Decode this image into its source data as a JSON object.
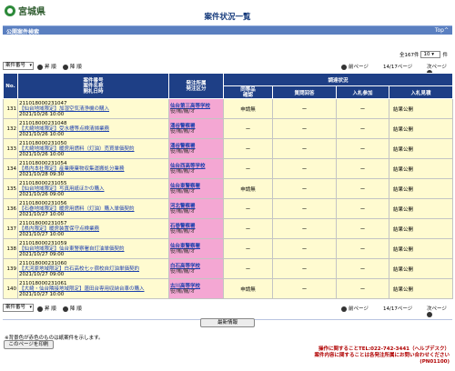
{
  "header": {
    "logo_text": "宮城県",
    "page_title": "案件状況一覧"
  },
  "bar": {
    "title": "公開案件検索",
    "top_link": "Top^"
  },
  "controls": {
    "sort_select": "案件番号",
    "sort_up": "昇 順",
    "sort_down": "降 順",
    "prev_label": "前ページ",
    "page_info": "14/17ページ",
    "next_label": "次ページ"
  },
  "count": {
    "total": "全167件",
    "per_page": "10",
    "unit": "件"
  },
  "table": {
    "headers": {
      "no": "No.",
      "case": "案件番号\n案件名称\n開札日時",
      "dept": "発注所属\n発注区分",
      "survey": "調達状況",
      "same_item": "同等品\n確認",
      "question": "質問回答",
      "bid_join": "入札参加",
      "bid_result": "入札見積"
    },
    "rows": [
      {
        "no": "131",
        "num": "211018000231047",
        "name": "【仙台地域限定】加湿空気清浄機の購入",
        "date": "2021/10/26 10:00",
        "office": "仙台第三高等学校",
        "dtype": "役/賄/購/オ",
        "same": "申請無",
        "q": "ー",
        "join": "ー",
        "result": "結果公開"
      },
      {
        "no": "132",
        "num": "211018000231048",
        "name": "【大崎地域限定】受水槽等点検清掃業務",
        "date": "2021/10/26 10:00",
        "office": "涌谷警察署",
        "dtype": "役/賄/賄/オ",
        "same": "ー",
        "q": "ー",
        "join": "ー",
        "result": "結果公開"
      },
      {
        "no": "133",
        "num": "211018000231050",
        "name": "【大崎地域限定】暖房用燃料（灯油）売買単価契約",
        "date": "2021/10/26 10:00",
        "office": "涌谷警察署",
        "dtype": "役/賄/購/オ",
        "same": "ー",
        "q": "ー",
        "join": "ー",
        "result": "結果公開"
      },
      {
        "no": "134",
        "num": "211018000231054",
        "name": "【県内本社限定】産業廃棄物収集運搬処分業務",
        "date": "2021/10/28 09:30",
        "office": "仙台西高等学校",
        "dtype": "役/賄/賄/オ",
        "same": "ー",
        "q": "ー",
        "join": "ー",
        "result": "結果公開"
      },
      {
        "no": "135",
        "num": "211018000231055",
        "name": "【仙台地域限定】写真用紙ほかの購入",
        "date": "2021/10/26 09:00",
        "office": "仙台東警察署",
        "dtype": "役/賄/購/オ",
        "same": "申請無",
        "q": "ー",
        "join": "ー",
        "result": "結果公開"
      },
      {
        "no": "136",
        "num": "211018000231056",
        "name": "【石巻地域限定】暖房用燃料（灯油）購入単価契約",
        "date": "2021/10/27 10:00",
        "office": "河北警察署",
        "dtype": "役/賄/購/オ",
        "same": "ー",
        "q": "ー",
        "join": "ー",
        "result": "結果公開"
      },
      {
        "no": "137",
        "num": "211018000231057",
        "name": "【県内限定】暖房装置保守点検業務",
        "date": "2021/10/27 10:00",
        "office": "石巻警察署",
        "dtype": "役/賄/賄/オ",
        "same": "ー",
        "q": "ー",
        "join": "ー",
        "result": "結果公開"
      },
      {
        "no": "138",
        "num": "211018000231059",
        "name": "【仙台地域限定】仙台東警察署自灯油単価契約",
        "date": "2021/10/27 09:00",
        "office": "仙台東警察署",
        "dtype": "役/賄/購/オ",
        "same": "ー",
        "q": "ー",
        "join": "ー",
        "result": "結果公開"
      },
      {
        "no": "139",
        "num": "211018000231060",
        "name": "【大河原地域限定】白石高校七ヶ宿校自灯油単価契約",
        "date": "2021/10/27 09:00",
        "office": "白石高等学校",
        "dtype": "役/賄/購/オ",
        "same": "ー",
        "q": "ー",
        "join": "ー",
        "result": "結果公開"
      },
      {
        "no": "140",
        "num": "211018000231061",
        "name": "【大崎・仙台隣接地域限定】蓮田台専用収納台車の購入",
        "date": "2021/10/27 10:00",
        "office": "古川高等学校",
        "dtype": "役/賄/購/オ",
        "same": "申請無",
        "q": "ー",
        "join": "ー",
        "result": "結果公開"
      }
    ]
  },
  "footer": {
    "latest_button": "最新情報",
    "note": "※背景色が赤色のものは紙案件を示します。",
    "print_button": "このページを印刷",
    "contact_line1": "操作に関することTEL:022-742-3441（ヘルプデスク）",
    "contact_line2": "案件内容に関することは各発注所属にお問い合わせください",
    "code": "(PN01100)"
  }
}
